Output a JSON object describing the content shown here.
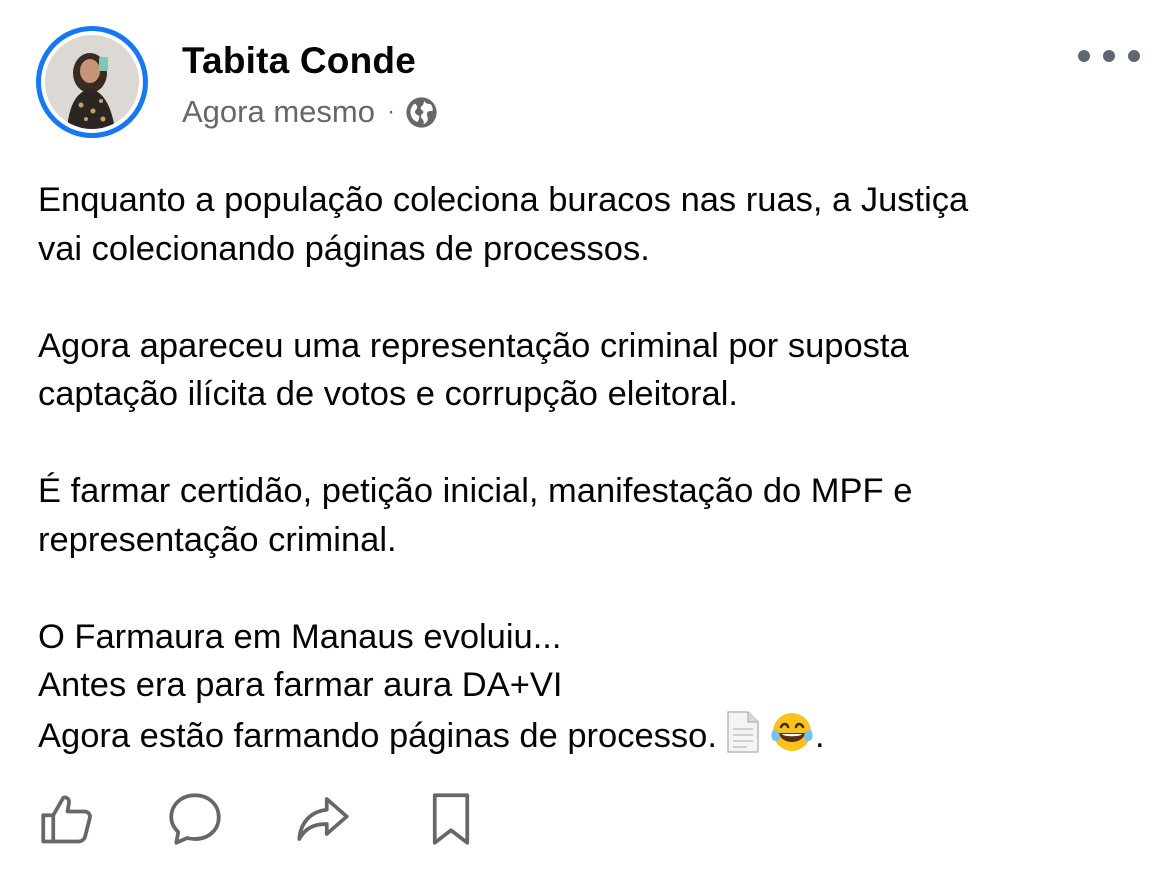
{
  "post": {
    "author": "Tabita Conde",
    "timestamp": "Agora mesmo",
    "separator": "·",
    "audience_icon": "globe-icon",
    "paragraphs": [
      {
        "lines": [
          "Enquanto a população coleciona buracos nas ruas, a Justiça",
          "vai colecionando páginas de processos."
        ]
      },
      {
        "lines": [
          "Agora apareceu uma representação criminal por suposta",
          "captação ilícita de votos e corrupção eleitoral."
        ]
      },
      {
        "lines": [
          "É farmar certidão, petição inicial, manifestação do MPF e",
          "representação criminal."
        ]
      },
      {
        "lines": [
          "O Farmaura em Manaus evoluiu...",
          "Antes era para farmar aura DA+VI",
          "Agora estão farmando páginas de processo."
        ],
        "trailing_emojis": [
          "page-facing-up-emoji",
          "tears-of-joy-emoji"
        ],
        "trailing_text": "."
      }
    ]
  },
  "header": {
    "more_icon": "more-horizontal-icon"
  },
  "actions": [
    {
      "name": "like-button",
      "icon": "thumbs-up-icon"
    },
    {
      "name": "comment-button",
      "icon": "comment-bubble-icon"
    },
    {
      "name": "share-button",
      "icon": "share-arrow-icon"
    },
    {
      "name": "save-button",
      "icon": "bookmark-icon"
    }
  ],
  "colors": {
    "accent": "#1877f2",
    "text": "#050505",
    "secondary_text": "#65676b",
    "icon": "#606770"
  }
}
